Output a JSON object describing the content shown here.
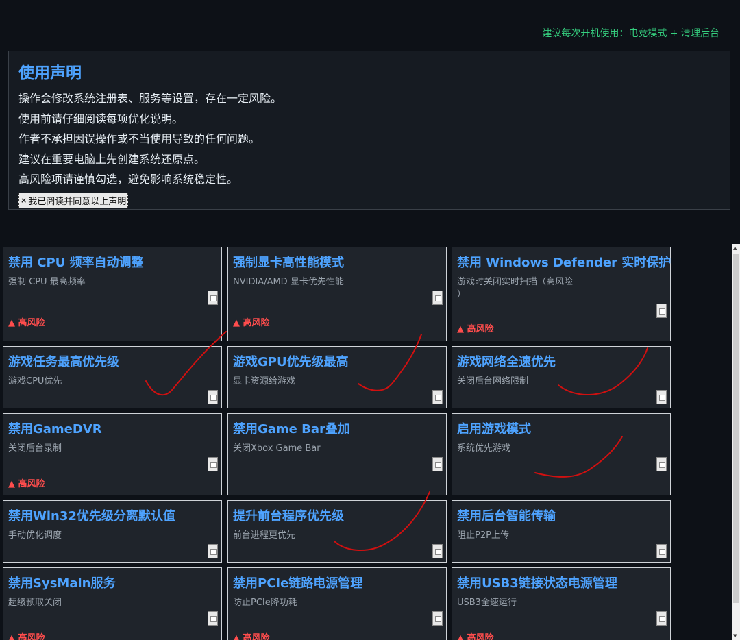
{
  "header": {
    "recommendation": "建议每次开机使用：电竞模式 + 清理后台"
  },
  "notice": {
    "title": "使用声明",
    "lines": [
      "操作会修改系统注册表、服务等设置，存在一定风险。",
      "使用前请仔细阅读每项优化说明。",
      "作者不承担因误操作或不当使用导致的任何问题。",
      "建议在重要电脑上先创建系统还原点。",
      "高风险项请谨慎勾选，避免影响系统稳定性。"
    ],
    "agree_label": "我已阅读并同意以上声明",
    "agree_mark": "×"
  },
  "risk_label": "▲ 高风险",
  "cards": [
    {
      "title": "禁用 CPU 频率自动调整",
      "desc": "强制 CPU 最高频率",
      "risk": true
    },
    {
      "title": "强制显卡高性能模式",
      "desc": "NVIDIA/AMD 显卡优先性能",
      "risk": true
    },
    {
      "title": "禁用 Windows Defender 实时保护",
      "desc": "游戏时关闭实时扫描（高风险\n）",
      "risk": true
    },
    {
      "title": "游戏任务最高优先级",
      "desc": "游戏CPU优先",
      "risk": false
    },
    {
      "title": "游戏GPU优先级最高",
      "desc": "显卡资源给游戏",
      "risk": false
    },
    {
      "title": "游戏网络全速优先",
      "desc": "关闭后台网络限制",
      "risk": false
    },
    {
      "title": "禁用GameDVR",
      "desc": "关闭后台录制",
      "risk": true
    },
    {
      "title": "禁用Game Bar叠加",
      "desc": "关闭Xbox Game Bar",
      "risk": false
    },
    {
      "title": "启用游戏模式",
      "desc": "系统优先游戏",
      "risk": false
    },
    {
      "title": "禁用Win32优先级分离默认值",
      "desc": "手动优化调度",
      "risk": false
    },
    {
      "title": "提升前台程序优先级",
      "desc": "前台进程更优先",
      "risk": false
    },
    {
      "title": "禁用后台智能传输",
      "desc": "阻止P2P上传",
      "risk": false
    },
    {
      "title": "禁用SysMain服务",
      "desc": "超级预取关闭",
      "risk": true
    },
    {
      "title": "禁用PCIe链路电源管理",
      "desc": "防止PCIe降功耗",
      "risk": true
    },
    {
      "title": "禁用USB3链接状态电源管理",
      "desc": "USB3全速运行",
      "risk": true
    }
  ],
  "colors": {
    "accent": "#4ea3ff",
    "risk": "#ff4d4d",
    "recommend": "#35d07f",
    "annotation": "#d01010"
  }
}
